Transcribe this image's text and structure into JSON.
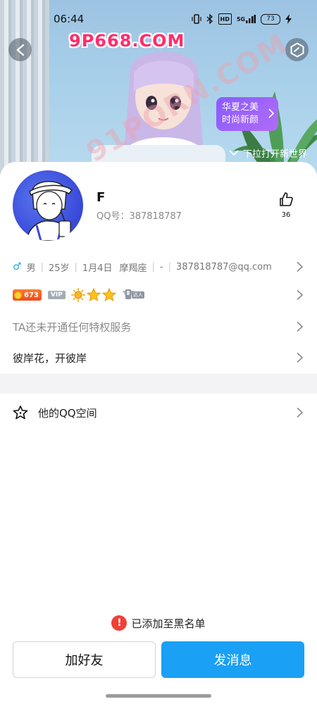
{
  "status_bar": {
    "time": "06:44",
    "network": "5G",
    "hd_label": "HD",
    "battery": "73"
  },
  "watermark": {
    "site": "9P668.COM",
    "diagonal": "91PORN.COM"
  },
  "hero": {
    "promo_line1": "华夏之美",
    "promo_line2": "时尚新颜",
    "pull_hint": "下拉打开新世界"
  },
  "profile": {
    "nickname": "F",
    "qq_id": "QQ号：387818787",
    "like_count": "36"
  },
  "info": {
    "gender": "男",
    "age": "25岁",
    "birthday": "1月4日",
    "zodiac": "摩羯座",
    "location": "-",
    "email": "387818787@qq.com"
  },
  "badges": {
    "coin_value": "673",
    "vip_label": "VIP",
    "achievement_label": "达人"
  },
  "privilege_text": "TA还未开通任何特权服务",
  "signature": "彼岸花，开彼岸",
  "qzone_label": "他的QQ空间",
  "notice": "已添加至黑名单",
  "actions": {
    "add_friend": "加好友",
    "send_message": "发消息"
  },
  "colors": {
    "primary_blue": "#1aa0f5",
    "warning_red": "#f04038",
    "promo_purple": "#8a5bff"
  }
}
